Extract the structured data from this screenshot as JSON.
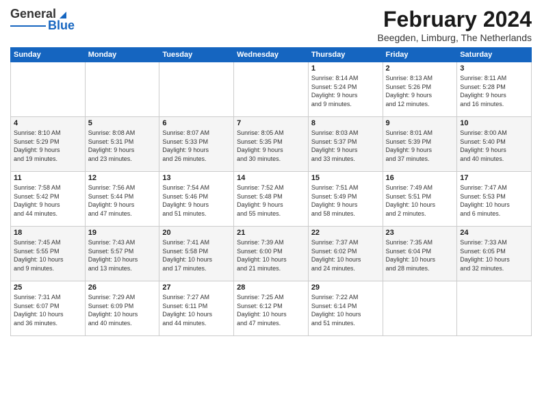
{
  "logo": {
    "line1": "General",
    "line2": "Blue"
  },
  "header": {
    "month_title": "February 2024",
    "location": "Beegden, Limburg, The Netherlands"
  },
  "days_of_week": [
    "Sunday",
    "Monday",
    "Tuesday",
    "Wednesday",
    "Thursday",
    "Friday",
    "Saturday"
  ],
  "weeks": [
    [
      {
        "day": "",
        "info": ""
      },
      {
        "day": "",
        "info": ""
      },
      {
        "day": "",
        "info": ""
      },
      {
        "day": "",
        "info": ""
      },
      {
        "day": "1",
        "info": "Sunrise: 8:14 AM\nSunset: 5:24 PM\nDaylight: 9 hours\nand 9 minutes."
      },
      {
        "day": "2",
        "info": "Sunrise: 8:13 AM\nSunset: 5:26 PM\nDaylight: 9 hours\nand 12 minutes."
      },
      {
        "day": "3",
        "info": "Sunrise: 8:11 AM\nSunset: 5:28 PM\nDaylight: 9 hours\nand 16 minutes."
      }
    ],
    [
      {
        "day": "4",
        "info": "Sunrise: 8:10 AM\nSunset: 5:29 PM\nDaylight: 9 hours\nand 19 minutes."
      },
      {
        "day": "5",
        "info": "Sunrise: 8:08 AM\nSunset: 5:31 PM\nDaylight: 9 hours\nand 23 minutes."
      },
      {
        "day": "6",
        "info": "Sunrise: 8:07 AM\nSunset: 5:33 PM\nDaylight: 9 hours\nand 26 minutes."
      },
      {
        "day": "7",
        "info": "Sunrise: 8:05 AM\nSunset: 5:35 PM\nDaylight: 9 hours\nand 30 minutes."
      },
      {
        "day": "8",
        "info": "Sunrise: 8:03 AM\nSunset: 5:37 PM\nDaylight: 9 hours\nand 33 minutes."
      },
      {
        "day": "9",
        "info": "Sunrise: 8:01 AM\nSunset: 5:39 PM\nDaylight: 9 hours\nand 37 minutes."
      },
      {
        "day": "10",
        "info": "Sunrise: 8:00 AM\nSunset: 5:40 PM\nDaylight: 9 hours\nand 40 minutes."
      }
    ],
    [
      {
        "day": "11",
        "info": "Sunrise: 7:58 AM\nSunset: 5:42 PM\nDaylight: 9 hours\nand 44 minutes."
      },
      {
        "day": "12",
        "info": "Sunrise: 7:56 AM\nSunset: 5:44 PM\nDaylight: 9 hours\nand 47 minutes."
      },
      {
        "day": "13",
        "info": "Sunrise: 7:54 AM\nSunset: 5:46 PM\nDaylight: 9 hours\nand 51 minutes."
      },
      {
        "day": "14",
        "info": "Sunrise: 7:52 AM\nSunset: 5:48 PM\nDaylight: 9 hours\nand 55 minutes."
      },
      {
        "day": "15",
        "info": "Sunrise: 7:51 AM\nSunset: 5:49 PM\nDaylight: 9 hours\nand 58 minutes."
      },
      {
        "day": "16",
        "info": "Sunrise: 7:49 AM\nSunset: 5:51 PM\nDaylight: 10 hours\nand 2 minutes."
      },
      {
        "day": "17",
        "info": "Sunrise: 7:47 AM\nSunset: 5:53 PM\nDaylight: 10 hours\nand 6 minutes."
      }
    ],
    [
      {
        "day": "18",
        "info": "Sunrise: 7:45 AM\nSunset: 5:55 PM\nDaylight: 10 hours\nand 9 minutes."
      },
      {
        "day": "19",
        "info": "Sunrise: 7:43 AM\nSunset: 5:57 PM\nDaylight: 10 hours\nand 13 minutes."
      },
      {
        "day": "20",
        "info": "Sunrise: 7:41 AM\nSunset: 5:58 PM\nDaylight: 10 hours\nand 17 minutes."
      },
      {
        "day": "21",
        "info": "Sunrise: 7:39 AM\nSunset: 6:00 PM\nDaylight: 10 hours\nand 21 minutes."
      },
      {
        "day": "22",
        "info": "Sunrise: 7:37 AM\nSunset: 6:02 PM\nDaylight: 10 hours\nand 24 minutes."
      },
      {
        "day": "23",
        "info": "Sunrise: 7:35 AM\nSunset: 6:04 PM\nDaylight: 10 hours\nand 28 minutes."
      },
      {
        "day": "24",
        "info": "Sunrise: 7:33 AM\nSunset: 6:05 PM\nDaylight: 10 hours\nand 32 minutes."
      }
    ],
    [
      {
        "day": "25",
        "info": "Sunrise: 7:31 AM\nSunset: 6:07 PM\nDaylight: 10 hours\nand 36 minutes."
      },
      {
        "day": "26",
        "info": "Sunrise: 7:29 AM\nSunset: 6:09 PM\nDaylight: 10 hours\nand 40 minutes."
      },
      {
        "day": "27",
        "info": "Sunrise: 7:27 AM\nSunset: 6:11 PM\nDaylight: 10 hours\nand 44 minutes."
      },
      {
        "day": "28",
        "info": "Sunrise: 7:25 AM\nSunset: 6:12 PM\nDaylight: 10 hours\nand 47 minutes."
      },
      {
        "day": "29",
        "info": "Sunrise: 7:22 AM\nSunset: 6:14 PM\nDaylight: 10 hours\nand 51 minutes."
      },
      {
        "day": "",
        "info": ""
      },
      {
        "day": "",
        "info": ""
      }
    ]
  ]
}
